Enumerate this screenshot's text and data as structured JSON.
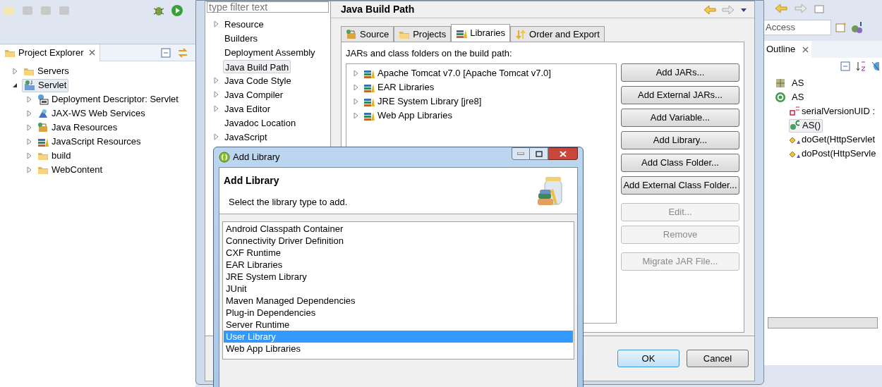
{
  "project_explorer": {
    "title": "Project Explorer",
    "tree": [
      {
        "label": "Servers",
        "kind": "folder",
        "expanded": false,
        "selected": false
      },
      {
        "label": "Servlet",
        "kind": "project",
        "expanded": true,
        "selected": true,
        "children": [
          {
            "label": "Deployment Descriptor: Servlet",
            "kind": "descriptor",
            "expanded": false,
            "selected": false
          },
          {
            "label": "JAX-WS Web Services",
            "kind": "webservice",
            "expanded": false,
            "selected": false
          },
          {
            "label": "Java Resources",
            "kind": "package",
            "expanded": false,
            "selected": false
          },
          {
            "label": "JavaScript Resources",
            "kind": "library",
            "expanded": false,
            "selected": false
          },
          {
            "label": "build",
            "kind": "folder",
            "expanded": false,
            "selected": false
          },
          {
            "label": "WebContent",
            "kind": "folder",
            "expanded": false,
            "selected": false
          }
        ]
      }
    ]
  },
  "properties_dialog": {
    "filter_placeholder": "type filter text",
    "nav": [
      {
        "label": "Resource",
        "expandable": true,
        "selected": false
      },
      {
        "label": "Builders",
        "expandable": false,
        "selected": false
      },
      {
        "label": "Deployment Assembly",
        "expandable": false,
        "selected": false
      },
      {
        "label": "Java Build Path",
        "expandable": false,
        "selected": true
      },
      {
        "label": "Java Code Style",
        "expandable": true,
        "selected": false
      },
      {
        "label": "Java Compiler",
        "expandable": true,
        "selected": false
      },
      {
        "label": "Java Editor",
        "expandable": true,
        "selected": false
      },
      {
        "label": "Javadoc Location",
        "expandable": false,
        "selected": false
      },
      {
        "label": "JavaScript",
        "expandable": true,
        "selected": false
      }
    ],
    "page_title": "Java Build Path",
    "tabs": [
      {
        "label": "Source",
        "kind": "package",
        "selected": false
      },
      {
        "label": "Projects",
        "kind": "folder",
        "selected": false
      },
      {
        "label": "Libraries",
        "kind": "library",
        "selected": true
      },
      {
        "label": "Order and Export",
        "kind": "order",
        "selected": false
      }
    ],
    "description": "JARs and class folders on the build path:",
    "libraries": [
      {
        "label": "Apache Tomcat v7.0 [Apache Tomcat v7.0]"
      },
      {
        "label": "EAR Libraries"
      },
      {
        "label": "JRE System Library [jre8]"
      },
      {
        "label": "Web App Libraries"
      }
    ],
    "button_groups": [
      [
        {
          "label": "Add JARs...",
          "disabled": false
        },
        {
          "label": "Add External JARs...",
          "disabled": false
        },
        {
          "label": "Add Variable...",
          "disabled": false
        },
        {
          "label": "Add Library...",
          "disabled": false
        },
        {
          "label": "Add Class Folder...",
          "disabled": false
        },
        {
          "label": "Add External Class Folder...",
          "disabled": false
        }
      ],
      [
        {
          "label": "Edit...",
          "disabled": true
        },
        {
          "label": "Remove",
          "disabled": true
        }
      ],
      [
        {
          "label": "Migrate JAR File...",
          "disabled": true
        }
      ]
    ],
    "footer_buttons": [
      {
        "label": "OK",
        "default": true
      },
      {
        "label": "Cancel",
        "default": false
      }
    ]
  },
  "outline": {
    "quick_access": "Access",
    "title": "Outline",
    "items": [
      {
        "label": "AS",
        "kind": "imports",
        "selected": false
      },
      {
        "label": "AS",
        "kind": "class",
        "selected": false,
        "children": [
          {
            "label": "serialVersionUID :",
            "kind": "field",
            "selected": false
          },
          {
            "label": "AS()",
            "kind": "constructor",
            "selected": true
          },
          {
            "label": "doGet(HttpServlet",
            "kind": "method",
            "selected": false
          },
          {
            "label": "doPost(HttpServle",
            "kind": "method",
            "selected": false
          }
        ]
      }
    ]
  },
  "add_library": {
    "title": "Add Library",
    "heading": "Add Library",
    "description": "Select the library type to add.",
    "types": [
      {
        "label": "Android Classpath Container",
        "selected": false
      },
      {
        "label": "Connectivity Driver Definition",
        "selected": false
      },
      {
        "label": "CXF Runtime",
        "selected": false
      },
      {
        "label": "EAR Libraries",
        "selected": false
      },
      {
        "label": "JRE System Library",
        "selected": false
      },
      {
        "label": "JUnit",
        "selected": false
      },
      {
        "label": "Maven Managed Dependencies",
        "selected": false
      },
      {
        "label": "Plug-in Dependencies",
        "selected": false
      },
      {
        "label": "Server Runtime",
        "selected": false
      },
      {
        "label": "User Library",
        "selected": true
      },
      {
        "label": "Web App Libraries",
        "selected": false
      }
    ]
  }
}
